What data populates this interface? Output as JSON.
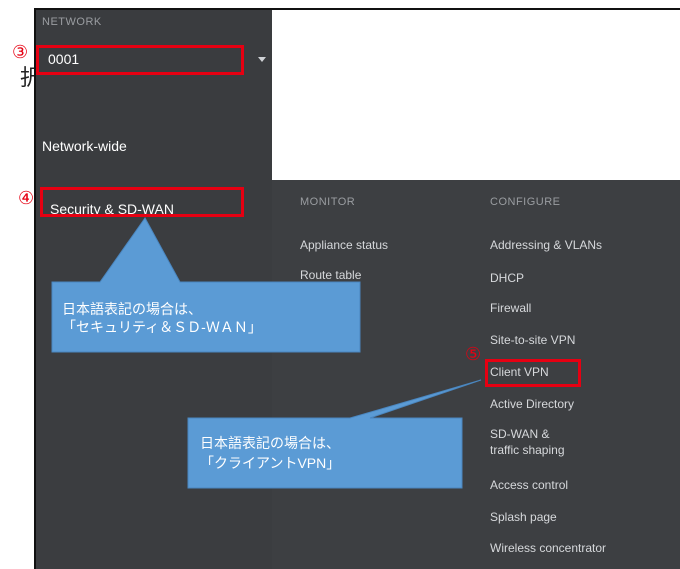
{
  "sidebar": {
    "network_label": "NETWORK",
    "network_value": "0001",
    "network_wide": "Network-wide",
    "security_sdwan": "Security & SD-WAN"
  },
  "flyout": {
    "monitor_header": "MONITOR",
    "configure_header": "CONFIGURE",
    "monitor_items": [
      "Appliance status",
      "Route table"
    ],
    "configure_items": [
      "Addressing & VLANs",
      "DHCP",
      "Firewall",
      "Site-to-site VPN",
      "Client VPN",
      "Active Directory",
      "SD-WAN &",
      "traffic shaping",
      "Access control",
      "Splash page",
      "Wireless concentrator"
    ]
  },
  "annotations": {
    "step3": "③",
    "step4": "④",
    "step5": "⑤",
    "truncated_char": "択",
    "callout1_line1": "日本語表記の場合は、",
    "callout1_line2": "「セキュリティ＆ＳＤ-ＷＡＮ」",
    "callout2_line1": "日本語表記の場合は、",
    "callout2_line2": "「クライアントVPN」",
    "highlight_color": "#e60012",
    "callout_color": "#5b9bd5"
  }
}
